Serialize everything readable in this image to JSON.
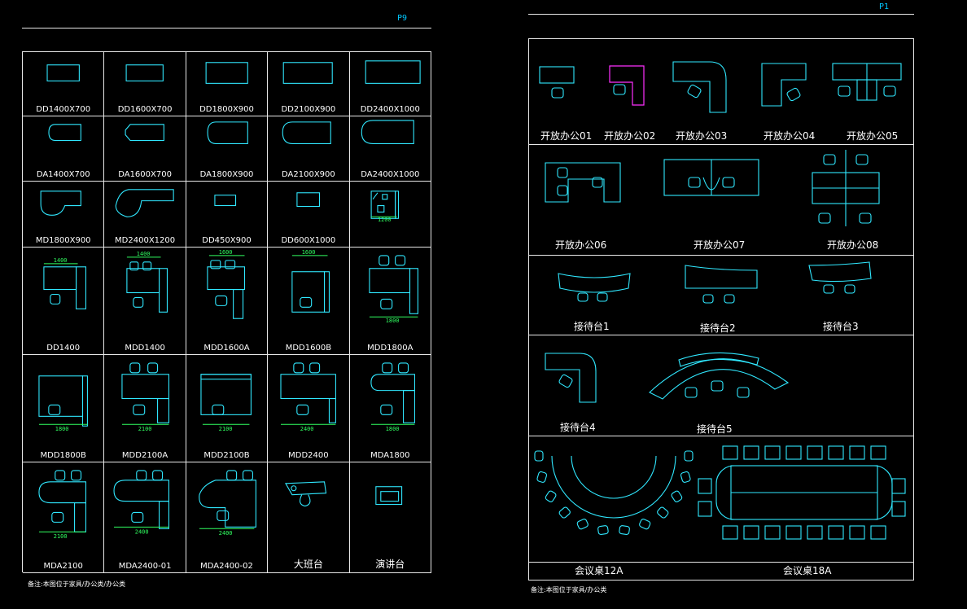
{
  "left_page": {
    "page_label": "P9",
    "captions": [
      "DD1400X700",
      "DD1600X700",
      "DD1800X900",
      "DD2100X900",
      "DD2400X1000",
      "DA1400X700",
      "DA1600X700",
      "DA1800X900",
      "DA2100X900",
      "DA2400X1000",
      "MD1800X900",
      "MD2400X1200",
      "DD450X900",
      "DD600X1000",
      "",
      "DD1400",
      "MDD1400",
      "MDD1600A",
      "MDD1600B",
      "MDD1800A",
      "MDD1800B",
      "MDD2100A",
      "MDD2100B",
      "MDD2400",
      "MDA1800",
      "MDA2100",
      "MDA2400-01",
      "MDA2400-02",
      "大班台",
      "演讲台"
    ],
    "dimension_labels": {
      "c14": "1200",
      "c15": "1400",
      "c16": "1400",
      "c17": "1600",
      "c18": "1600",
      "c19": "1800",
      "c20": "1800",
      "c21": "2100",
      "c22": "2100",
      "c23": "2400",
      "c24": "1800",
      "c25": "2100",
      "c26": "2400",
      "c27": "2400"
    },
    "note": "备注:本图位于家具/办公类/办公类"
  },
  "right_page": {
    "page_label": "P1",
    "captions": {
      "open1": "开放办公01",
      "open2": "开放办公02",
      "open3": "开放办公03",
      "open4": "开放办公04",
      "open5": "开放办公05",
      "open6": "开放办公06",
      "open7": "开放办公07",
      "open8": "开放办公08",
      "rec1": "接待台1",
      "rec2": "接待台2",
      "rec3": "接待台3",
      "rec4": "接待台4",
      "rec5": "接待台5",
      "conf12": "会议桌12A",
      "conf18": "会议桌18A"
    },
    "note": "备注:本图位于家具/办公类"
  },
  "colors": {
    "line": "#30e8ff",
    "dimension": "#30ff60",
    "highlight": "#ff30ff",
    "border": "#e8e8e8",
    "label": "#00c8ff"
  }
}
